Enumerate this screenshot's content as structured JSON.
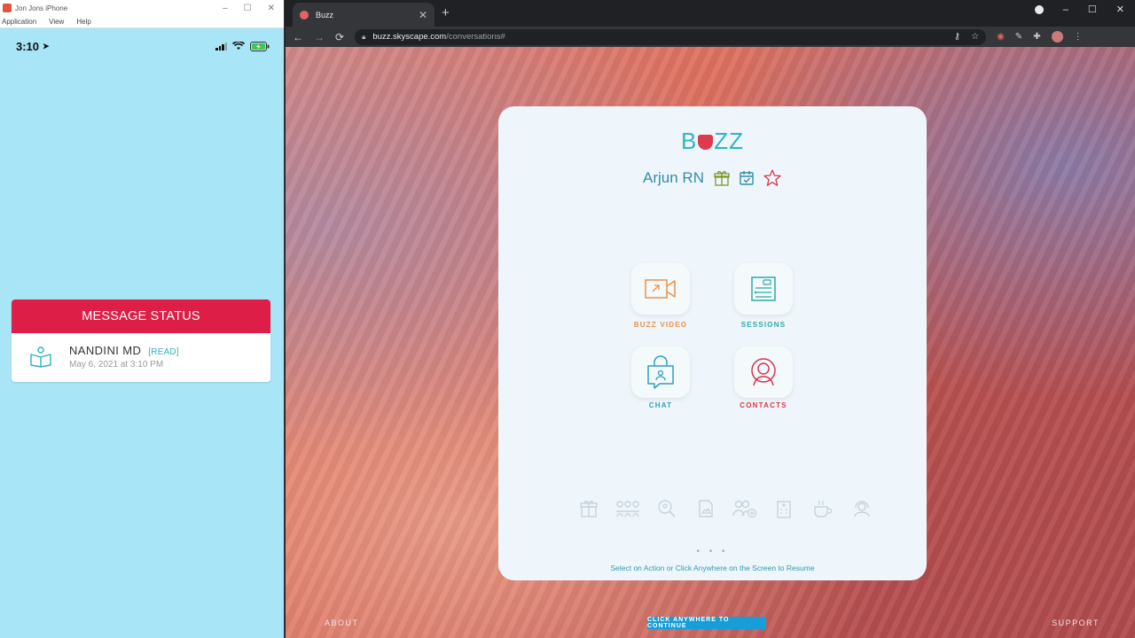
{
  "phone_window": {
    "title": "Jon Jons iPhone",
    "menu": [
      "Application",
      "View",
      "Help"
    ],
    "window_controls": [
      "–",
      "☐",
      "✕"
    ],
    "status_time": "3:10",
    "message_card": {
      "header": "MESSAGE STATUS",
      "sender": "NANDINI MD",
      "status": "[READ]",
      "timestamp": "May 6, 2021 at 3:10 PM"
    }
  },
  "browser": {
    "tab_title": "Buzz",
    "url_host": "buzz.skyscape.com",
    "url_path": "/conversations#",
    "window_controls": [
      "–",
      "☐",
      "✕"
    ]
  },
  "buzz": {
    "logo": {
      "left": "B",
      "right": "ZZ"
    },
    "user_name": "Arjun RN",
    "tiles": {
      "video": "BUZZ VIDEO",
      "sessions": "SESSIONS",
      "chat": "CHAT",
      "contacts": "CONTACTS"
    },
    "dots": "• • •",
    "hint": "Select on Action or Click Anywhere on the Screen to Resume"
  },
  "footer": {
    "about": "ABOUT",
    "continue": "CLICK ANYWHERE TO CONTINUE",
    "support": "SUPPORT"
  },
  "colors": {
    "accent_teal": "#2fb5c5",
    "header_red": "#dd1e47",
    "video_orange": "#e8914a",
    "contacts_red": "#d9364a",
    "continue_blue": "#159ed8"
  }
}
